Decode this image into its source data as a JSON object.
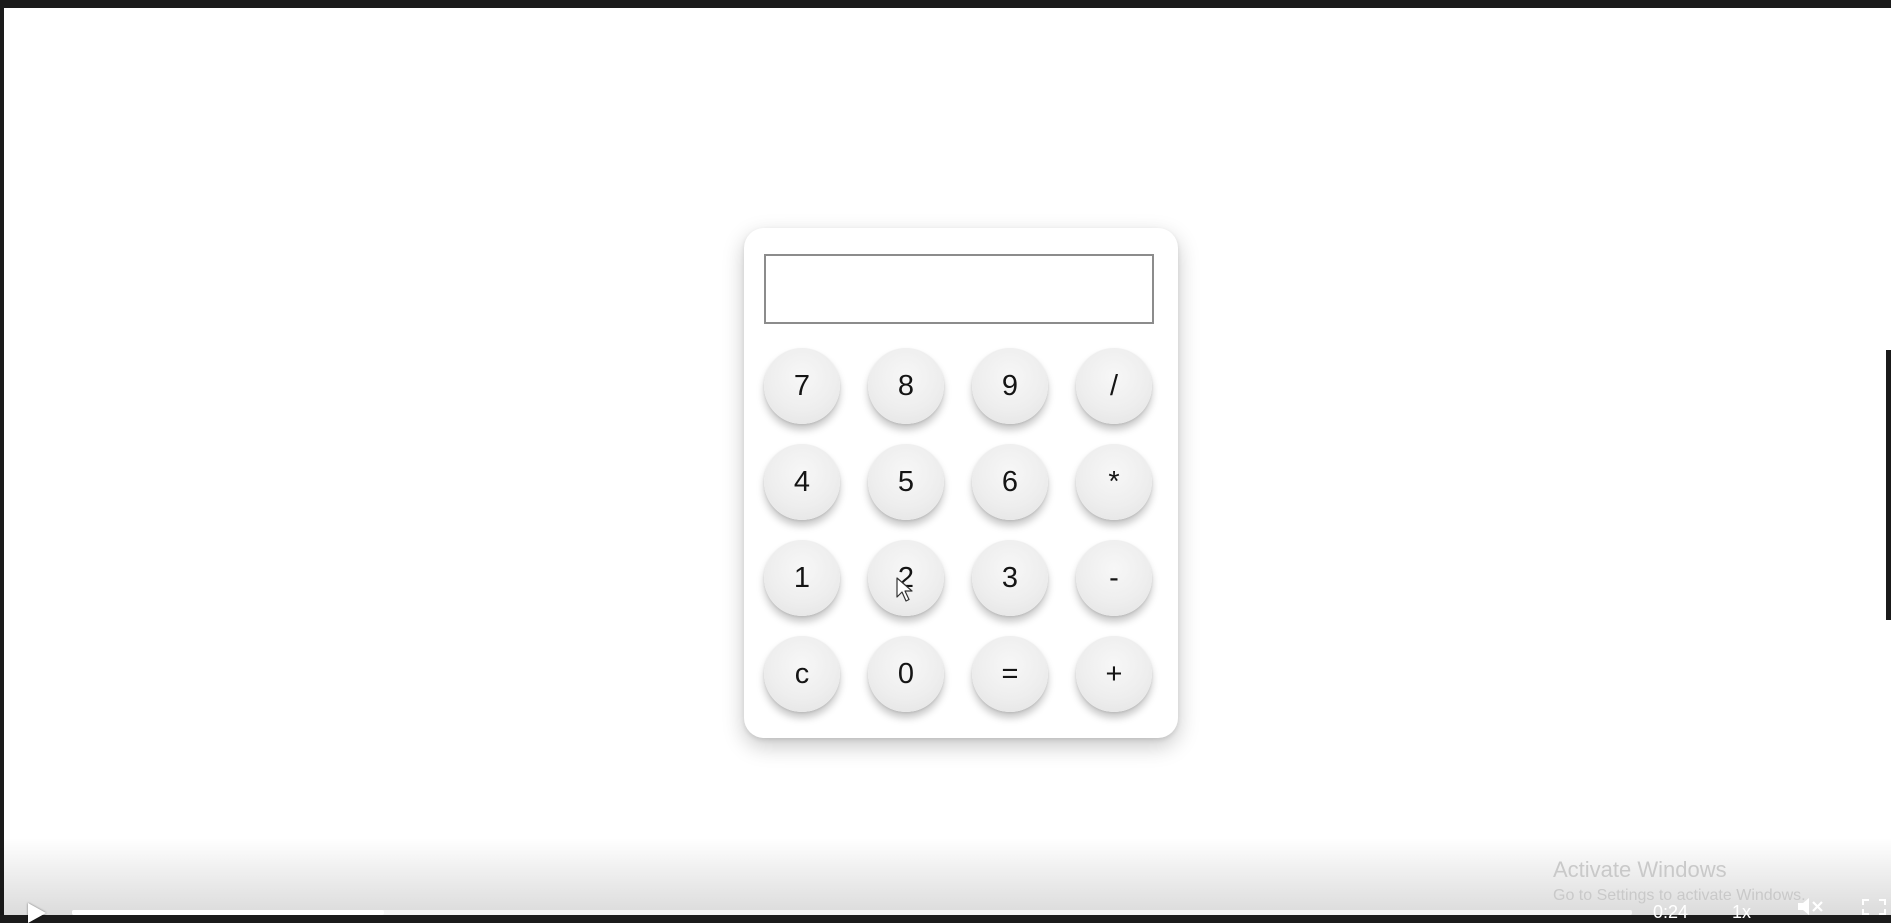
{
  "calculator": {
    "display": {
      "value": "",
      "placeholder": ""
    },
    "keys": [
      {
        "label": "7",
        "name": "key-7"
      },
      {
        "label": "8",
        "name": "key-8"
      },
      {
        "label": "9",
        "name": "key-9"
      },
      {
        "label": "/",
        "name": "key-divide"
      },
      {
        "label": "4",
        "name": "key-4"
      },
      {
        "label": "5",
        "name": "key-5"
      },
      {
        "label": "6",
        "name": "key-6"
      },
      {
        "label": "*",
        "name": "key-multiply"
      },
      {
        "label": "1",
        "name": "key-1"
      },
      {
        "label": "2",
        "name": "key-2"
      },
      {
        "label": "3",
        "name": "key-3"
      },
      {
        "label": "-",
        "name": "key-subtract"
      },
      {
        "label": "c",
        "name": "key-clear"
      },
      {
        "label": "0",
        "name": "key-0"
      },
      {
        "label": "=",
        "name": "key-equals"
      },
      {
        "label": "+",
        "name": "key-add"
      }
    ]
  },
  "video_player": {
    "time": "0:24",
    "speed": "1x",
    "progress": 0.2,
    "icons": {
      "play": "play-icon",
      "volume": "volume-muted-icon",
      "fullscreen": "fullscreen-icon"
    }
  },
  "watermark": {
    "title": "Activate Windows",
    "subtitle": "Go to Settings to activate Windows."
  }
}
